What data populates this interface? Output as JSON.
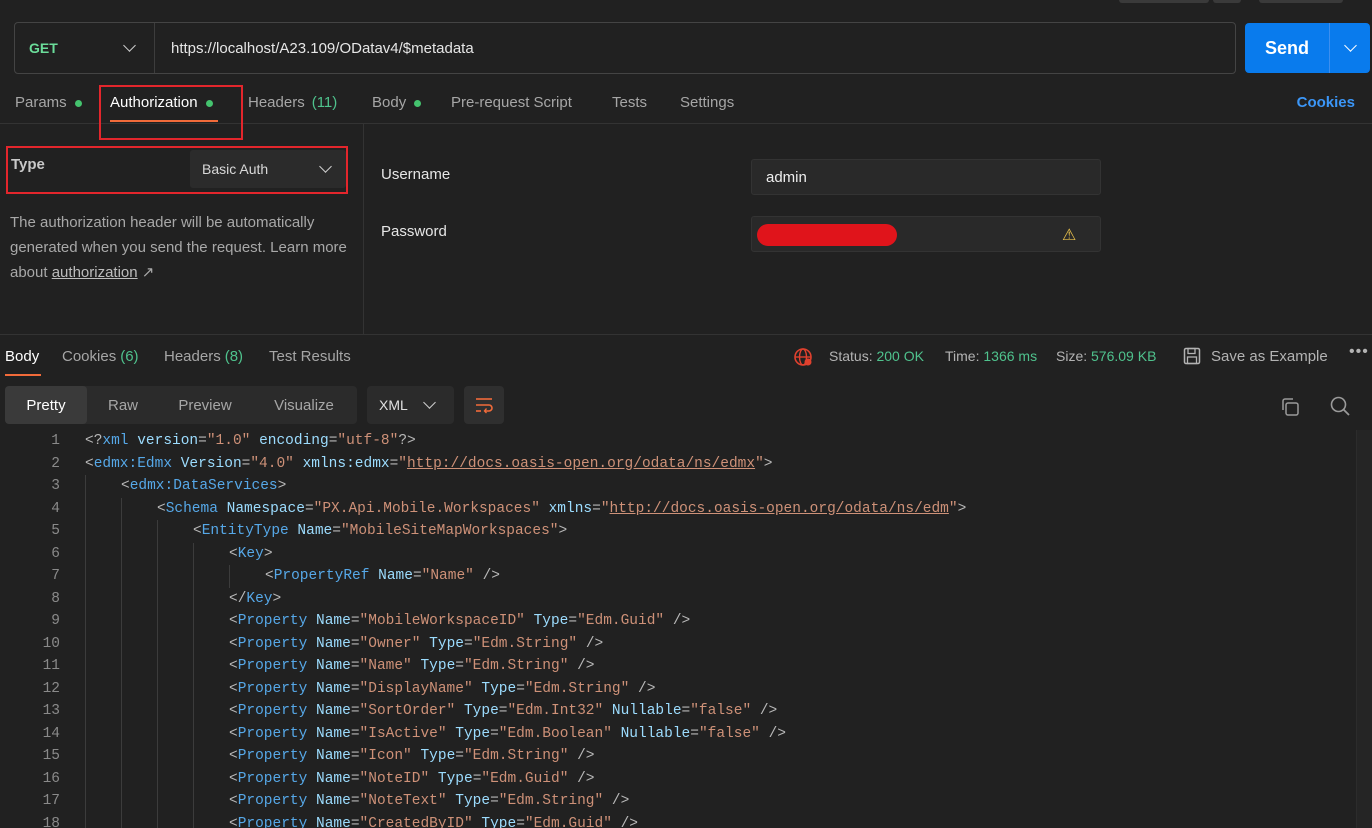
{
  "request": {
    "method": "GET",
    "url": "https://localhost/A23.109/ODatav4/$metadata",
    "send_label": "Send"
  },
  "request_tabs": {
    "params": "Params",
    "authorization": "Authorization",
    "headers": "Headers",
    "headers_count": "(11)",
    "body": "Body",
    "pre_request": "Pre-request Script",
    "tests": "Tests",
    "settings": "Settings",
    "cookies": "Cookies"
  },
  "auth": {
    "type_label": "Type",
    "type_value": "Basic Auth",
    "help_text": "The authorization header will be automatically generated when you send the request. Learn more about ",
    "help_link": "authorization",
    "help_arrow": "↗",
    "username_label": "Username",
    "username_value": "admin",
    "password_label": "Password",
    "warning_icon": "warning-icon"
  },
  "response_tabs": {
    "body": "Body",
    "cookies": "Cookies",
    "cookies_count": "(6)",
    "headers": "Headers",
    "headers_count": "(8)",
    "test_results": "Test Results"
  },
  "response_meta": {
    "status_label": "Status:",
    "status_value": "200 OK",
    "time_label": "Time:",
    "time_value": "1366 ms",
    "size_label": "Size:",
    "size_value": "576.09 KB",
    "save_example": "Save as Example",
    "more": "•••"
  },
  "view_modes": [
    "Pretty",
    "Raw",
    "Preview",
    "Visualize"
  ],
  "language": "XML",
  "code_lines": [
    {
      "n": "1",
      "indent": 0,
      "html": "<span class='p'>&lt;?</span><span class='tn'>xml</span> <span class='a'>version</span><span class='p'>=</span><span class='s'>\"1.0\"</span> <span class='a'>encoding</span><span class='p'>=</span><span class='s'>\"utf-8\"</span><span class='p'>?&gt;</span>"
    },
    {
      "n": "2",
      "indent": 0,
      "html": "<span class='p'>&lt;</span><span class='tn'>edmx:Edmx</span> <span class='a'>Version</span><span class='p'>=</span><span class='s'>\"4.0\"</span> <span class='a'>xmlns:edmx</span><span class='p'>=</span><span class='s'>\"</span><span class='u'>http://docs.oasis-open.org/odata/ns/edmx</span><span class='s'>\"</span><span class='p'>&gt;</span>"
    },
    {
      "n": "3",
      "indent": 1,
      "html": "<span class='p'>&lt;</span><span class='tn'>edmx:DataServices</span><span class='p'>&gt;</span>"
    },
    {
      "n": "4",
      "indent": 2,
      "html": "<span class='p'>&lt;</span><span class='tn'>Schema</span> <span class='a'>Namespace</span><span class='p'>=</span><span class='s'>\"PX.Api.Mobile.Workspaces\"</span> <span class='a'>xmlns</span><span class='p'>=</span><span class='s'>\"</span><span class='u'>http://docs.oasis-open.org/odata/ns/edm</span><span class='s'>\"</span><span class='p'>&gt;</span>"
    },
    {
      "n": "5",
      "indent": 3,
      "html": "<span class='p'>&lt;</span><span class='tn'>EntityType</span> <span class='a'>Name</span><span class='p'>=</span><span class='s'>\"MobileSiteMapWorkspaces\"</span><span class='p'>&gt;</span>"
    },
    {
      "n": "6",
      "indent": 4,
      "html": "<span class='p'>&lt;</span><span class='tn'>Key</span><span class='p'>&gt;</span>"
    },
    {
      "n": "7",
      "indent": 5,
      "html": "<span class='p'>&lt;</span><span class='tn'>PropertyRef</span> <span class='a'>Name</span><span class='p'>=</span><span class='s'>\"Name\"</span> <span class='p'>/&gt;</span>"
    },
    {
      "n": "8",
      "indent": 4,
      "html": "<span class='p'>&lt;/</span><span class='tn'>Key</span><span class='p'>&gt;</span>"
    },
    {
      "n": "9",
      "indent": 4,
      "html": "<span class='p'>&lt;</span><span class='tn'>Property</span> <span class='a'>Name</span><span class='p'>=</span><span class='s'>\"MobileWorkspaceID\"</span> <span class='a'>Type</span><span class='p'>=</span><span class='s'>\"Edm.Guid\"</span> <span class='p'>/&gt;</span>"
    },
    {
      "n": "10",
      "indent": 4,
      "html": "<span class='p'>&lt;</span><span class='tn'>Property</span> <span class='a'>Name</span><span class='p'>=</span><span class='s'>\"Owner\"</span> <span class='a'>Type</span><span class='p'>=</span><span class='s'>\"Edm.String\"</span> <span class='p'>/&gt;</span>"
    },
    {
      "n": "11",
      "indent": 4,
      "html": "<span class='p'>&lt;</span><span class='tn'>Property</span> <span class='a'>Name</span><span class='p'>=</span><span class='s'>\"Name\"</span> <span class='a'>Type</span><span class='p'>=</span><span class='s'>\"Edm.String\"</span> <span class='p'>/&gt;</span>"
    },
    {
      "n": "12",
      "indent": 4,
      "html": "<span class='p'>&lt;</span><span class='tn'>Property</span> <span class='a'>Name</span><span class='p'>=</span><span class='s'>\"DisplayName\"</span> <span class='a'>Type</span><span class='p'>=</span><span class='s'>\"Edm.String\"</span> <span class='p'>/&gt;</span>"
    },
    {
      "n": "13",
      "indent": 4,
      "html": "<span class='p'>&lt;</span><span class='tn'>Property</span> <span class='a'>Name</span><span class='p'>=</span><span class='s'>\"SortOrder\"</span> <span class='a'>Type</span><span class='p'>=</span><span class='s'>\"Edm.Int32\"</span> <span class='a'>Nullable</span><span class='p'>=</span><span class='s'>\"false\"</span> <span class='p'>/&gt;</span>"
    },
    {
      "n": "14",
      "indent": 4,
      "html": "<span class='p'>&lt;</span><span class='tn'>Property</span> <span class='a'>Name</span><span class='p'>=</span><span class='s'>\"IsActive\"</span> <span class='a'>Type</span><span class='p'>=</span><span class='s'>\"Edm.Boolean\"</span> <span class='a'>Nullable</span><span class='p'>=</span><span class='s'>\"false\"</span> <span class='p'>/&gt;</span>"
    },
    {
      "n": "15",
      "indent": 4,
      "html": "<span class='p'>&lt;</span><span class='tn'>Property</span> <span class='a'>Name</span><span class='p'>=</span><span class='s'>\"Icon\"</span> <span class='a'>Type</span><span class='p'>=</span><span class='s'>\"Edm.String\"</span> <span class='p'>/&gt;</span>"
    },
    {
      "n": "16",
      "indent": 4,
      "html": "<span class='p'>&lt;</span><span class='tn'>Property</span> <span class='a'>Name</span><span class='p'>=</span><span class='s'>\"NoteID\"</span> <span class='a'>Type</span><span class='p'>=</span><span class='s'>\"Edm.Guid\"</span> <span class='p'>/&gt;</span>"
    },
    {
      "n": "17",
      "indent": 4,
      "html": "<span class='p'>&lt;</span><span class='tn'>Property</span> <span class='a'>Name</span><span class='p'>=</span><span class='s'>\"NoteText\"</span> <span class='a'>Type</span><span class='p'>=</span><span class='s'>\"Edm.String\"</span> <span class='p'>/&gt;</span>"
    },
    {
      "n": "18",
      "indent": 4,
      "html": "<span class='p'>&lt;</span><span class='tn'>Property</span> <span class='a'>Name</span><span class='p'>=</span><span class='s'>\"CreatedByID\"</span> <span class='a'>Type</span><span class='p'>=</span><span class='s'>\"Edm.Guid\"</span> <span class='p'>/&gt;</span>"
    }
  ],
  "colors": {
    "accent_orange": "#f26b3a",
    "send_blue": "#097bed",
    "success_green": "#4fc28d",
    "highlight_red": "#e3262c"
  }
}
